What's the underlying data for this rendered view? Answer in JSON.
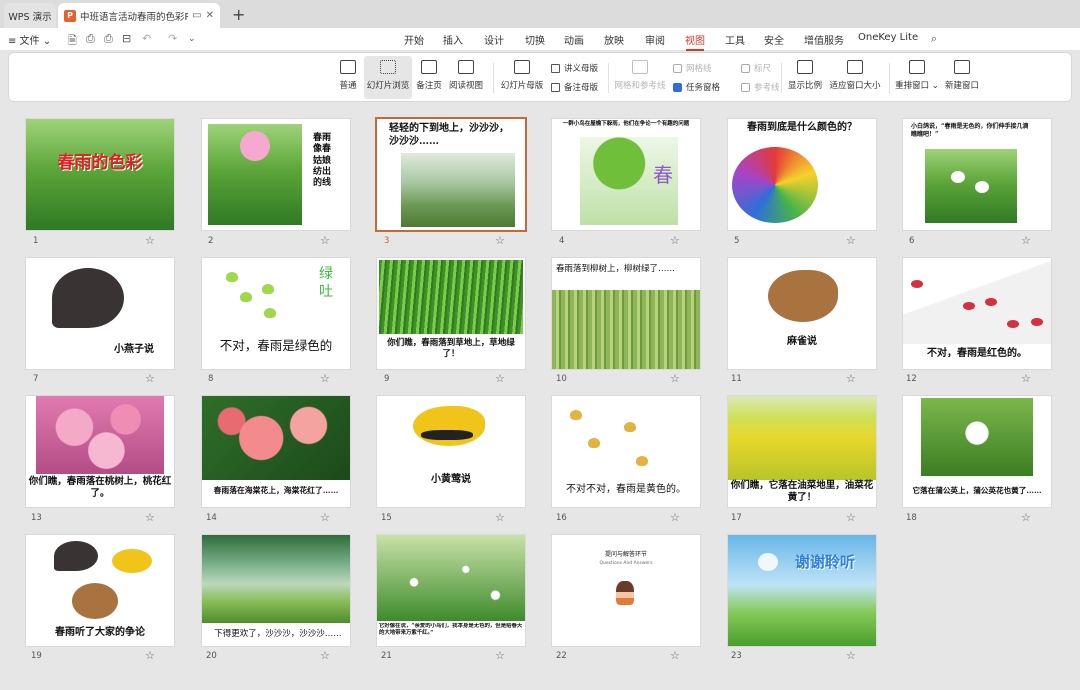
{
  "tabs": {
    "app": "WPS 演示",
    "doc_badge": "P",
    "doc_title": "中班语言活动春雨的色彩PPT课件",
    "add": "+"
  },
  "menu": {
    "file": "≡ 文件 ⌄"
  },
  "ribbon_tabs": [
    "开始",
    "插入",
    "设计",
    "切换",
    "动画",
    "放映",
    "审阅",
    "视图",
    "工具",
    "安全",
    "增值服务",
    "OneKey Lite"
  ],
  "active_ribbon_tab": "视图",
  "toolbar": {
    "normal": "普通",
    "slide_sorter": "幻灯片浏览",
    "notes_page": "备注页",
    "reading_view": "阅读视图",
    "slide_master": "幻灯片母版",
    "handout_master": "讲义母版",
    "notes_master": "备注母版",
    "grid_guides": "网格和参考线",
    "gridlines": "网格线",
    "ruler": "标尺",
    "task_pane": "任务窗格",
    "guides": "参考线",
    "zoom": "显示比例",
    "fit_window": "适应窗口大小",
    "arrange_windows": "重排窗口 ⌄",
    "new_window": "新建窗口"
  },
  "slides": [
    {
      "num": "1",
      "title": "春雨的色彩"
    },
    {
      "num": "2",
      "text": "春雨像春姑娘纺出的线"
    },
    {
      "num": "3",
      "text": "轻轻的下到地上，沙沙沙，沙沙沙……"
    },
    {
      "num": "4",
      "text": "一群小鸟在屋檐下躲雨，他们在争论一个有趣的问题",
      "glyph": "春"
    },
    {
      "num": "5",
      "text": "春雨到底是什么颜色的？"
    },
    {
      "num": "6",
      "text": "小白鸽说，“春雨是无色的，你们伸手接几滴瞧瞧吧！”"
    },
    {
      "num": "7",
      "text": "小燕子说"
    },
    {
      "num": "8",
      "text": "不对，春雨是绿色的",
      "side": "绿吐"
    },
    {
      "num": "9",
      "text": "你们瞧，春雨落到草地上，草地绿了！"
    },
    {
      "num": "10",
      "text": "春雨落到柳树上，柳树绿了……"
    },
    {
      "num": "11",
      "text": "麻雀说"
    },
    {
      "num": "12",
      "text": "不对，春雨是红色的。"
    },
    {
      "num": "13",
      "text": "你们瞧，春雨落在桃树上，桃花红了。"
    },
    {
      "num": "14",
      "text": "春雨落在海棠花上，海棠花红了……"
    },
    {
      "num": "15",
      "text": "小黄莺说"
    },
    {
      "num": "16",
      "text": "不对不对，春雨是黄色的。"
    },
    {
      "num": "17",
      "text": "你们瞧，它落在油菜地里，油菜花黄了！"
    },
    {
      "num": "18",
      "text": "它落在蒲公英上，蒲公英花也黄了……"
    },
    {
      "num": "19",
      "text": "春雨听了大家的争论"
    },
    {
      "num": "20",
      "text": "下得更欢了，沙沙沙，沙沙沙……"
    },
    {
      "num": "21",
      "text": "它好像在说，“亲爱的小鸟们，我本身是无色的，但是给春天的大地带来万紫千红。”"
    },
    {
      "num": "22",
      "text": "提问与解答环节",
      "sub": "Questions And Answers"
    },
    {
      "num": "23",
      "text": "谢谢聆听"
    }
  ],
  "selected_slide": "3",
  "star_glyph": "☆"
}
